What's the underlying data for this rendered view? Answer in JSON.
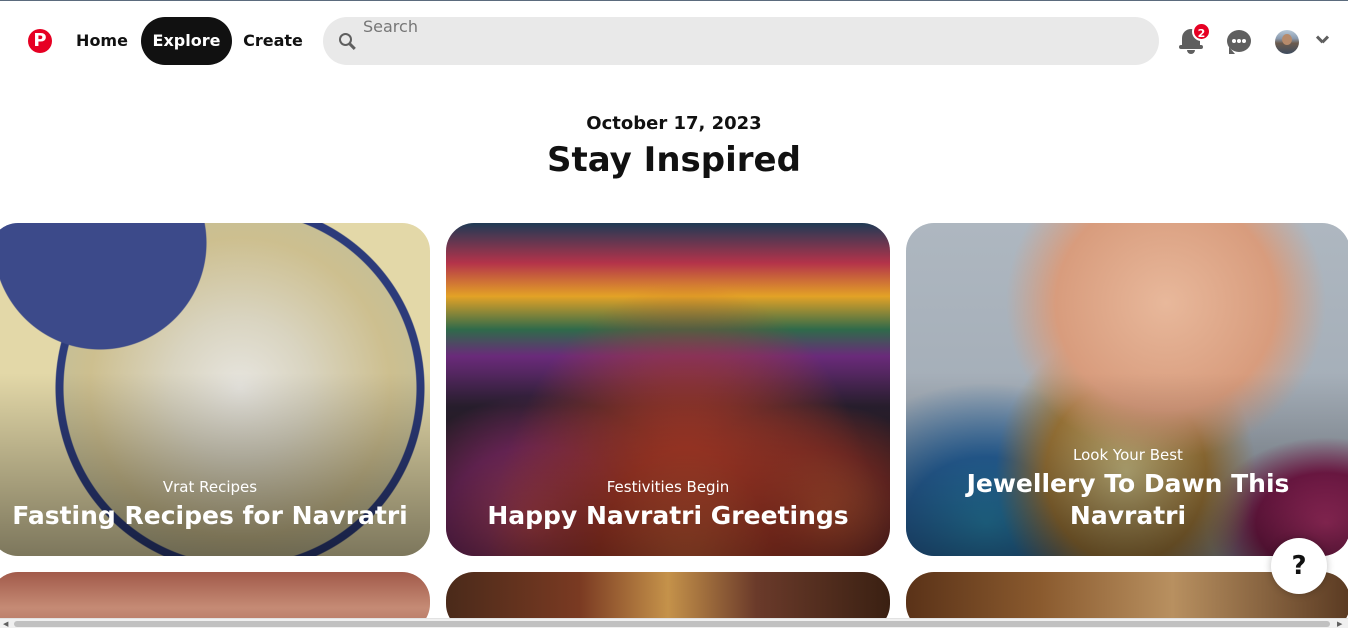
{
  "nav": {
    "logo_icon": "pinterest-logo-icon",
    "logo_glyph": "P",
    "home_label": "Home",
    "explore_label": "Explore",
    "create_label": "Create"
  },
  "search": {
    "placeholder": "Search",
    "icon": "search-icon"
  },
  "header_actions": {
    "notification_count": "2",
    "icons": [
      "bell-icon",
      "chat-icon",
      "avatar",
      "chevron-down-icon"
    ]
  },
  "page": {
    "date": "October 17, 2023",
    "title": "Stay Inspired"
  },
  "cards": [
    {
      "subtitle": "Vrat Recipes",
      "headline": "Fasting Recipes for Navratri"
    },
    {
      "subtitle": "Festivities Begin",
      "headline": "Happy Navratri Greetings"
    },
    {
      "subtitle": "Look Your Best",
      "headline": "Jewellery To Dawn This Navratri"
    }
  ],
  "help": {
    "label": "?"
  },
  "colors": {
    "brand": "#e60023",
    "active_nav_bg": "#111111",
    "search_bg": "#e9e9e9"
  }
}
